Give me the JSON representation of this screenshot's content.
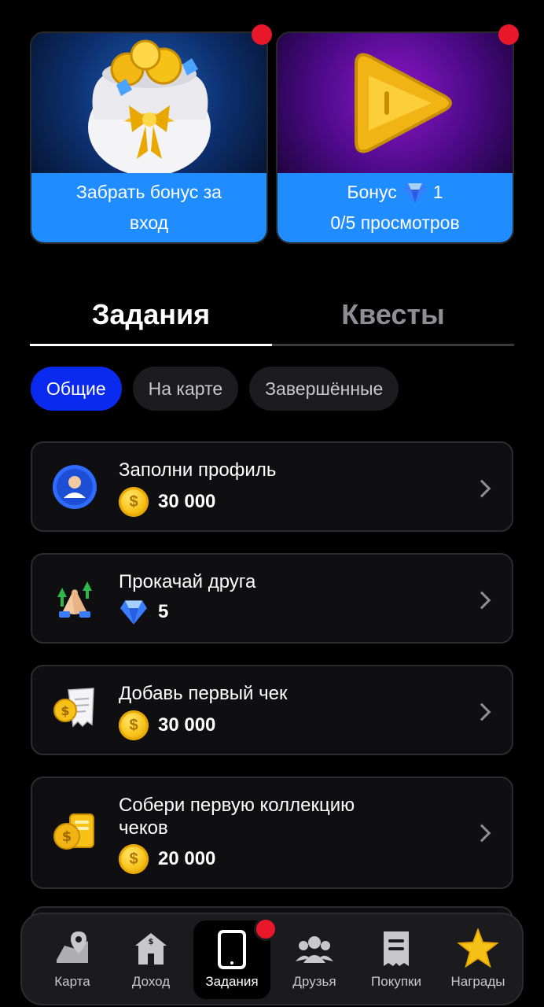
{
  "promos": [
    {
      "caption": "Забрать бонус за вход",
      "art_icon": "coin-bag-icon"
    },
    {
      "caption_line1_prefix": "Бонус",
      "caption_line1_value": "1",
      "caption_line2": "0/5 просмотров",
      "art_icon": "play-button-icon"
    }
  ],
  "tabs": [
    "Задания",
    "Квесты"
  ],
  "filters": [
    "Общие",
    "На карте",
    "Завершённые"
  ],
  "tasks": [
    {
      "title": "Заполни профиль",
      "reward": "30 000",
      "reward_type": "coin",
      "icon": "profile-icon"
    },
    {
      "title": "Прокачай друга",
      "reward": "5",
      "reward_type": "diamond",
      "icon": "high-five-icon"
    },
    {
      "title": "Добавь первый чек",
      "reward": "30 000",
      "reward_type": "coin",
      "icon": "receipt-icon"
    },
    {
      "title_line1": "Собери первую коллекцию",
      "title_line2": "чеков",
      "reward": "20 000",
      "reward_type": "coin",
      "icon": "receipt-collection-icon"
    }
  ],
  "nav": [
    {
      "label": "Карта",
      "icon": "map-icon"
    },
    {
      "label": "Доход",
      "icon": "shop-icon"
    },
    {
      "label": "Задания",
      "icon": "tablet-icon",
      "active": true
    },
    {
      "label": "Друзья",
      "icon": "friends-icon"
    },
    {
      "label": "Покупки",
      "icon": "receipt-icon"
    },
    {
      "label": "Награды",
      "icon": "star-icon"
    }
  ],
  "colors": {
    "accent": "#0a2af0",
    "caption_blue": "#1f8cff",
    "badge_red": "#e8182a",
    "gold": "#f7c218"
  }
}
